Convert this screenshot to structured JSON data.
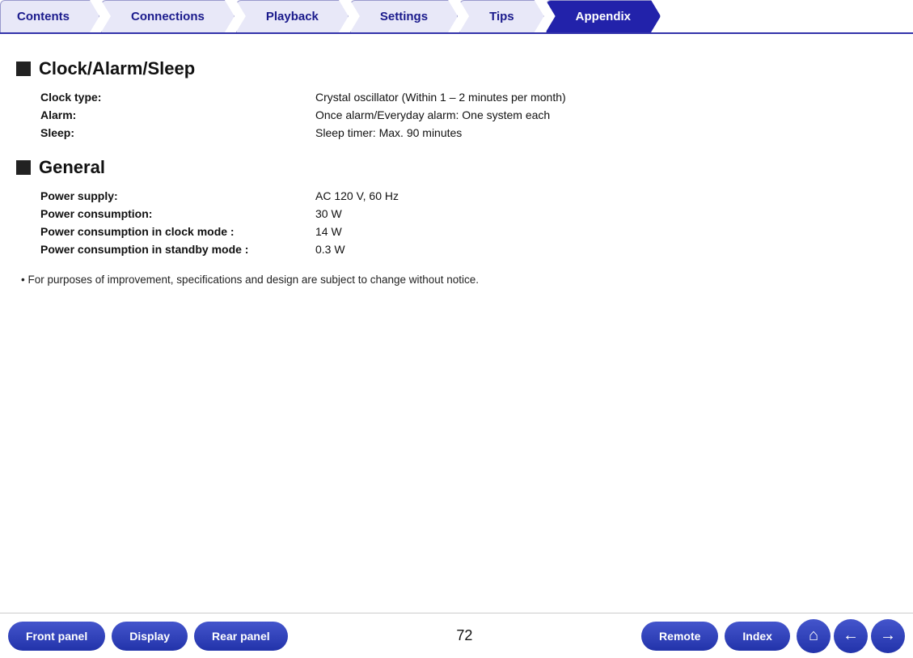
{
  "tabs": [
    {
      "label": "Contents",
      "active": false
    },
    {
      "label": "Connections",
      "active": false
    },
    {
      "label": "Playback",
      "active": false
    },
    {
      "label": "Settings",
      "active": false
    },
    {
      "label": "Tips",
      "active": false
    },
    {
      "label": "Appendix",
      "active": true
    }
  ],
  "sections": [
    {
      "id": "clock",
      "title": "Clock/Alarm/Sleep",
      "specs": [
        {
          "label": "Clock type:",
          "value": "Crystal oscillator (Within 1 – 2 minutes per month)"
        },
        {
          "label": "Alarm:",
          "value": "Once alarm/Everyday alarm: One system each"
        },
        {
          "label": "Sleep:",
          "value": "Sleep timer: Max. 90 minutes"
        }
      ]
    },
    {
      "id": "general",
      "title": "General",
      "specs": [
        {
          "label": "Power supply:",
          "value": "AC 120 V, 60 Hz"
        },
        {
          "label": "Power consumption:",
          "value": "30 W"
        },
        {
          "label": "Power consumption in clock mode :",
          "value": "14 W"
        },
        {
          "label": "Power consumption in standby mode :",
          "value": "0.3 W"
        }
      ]
    }
  ],
  "note": "For purposes of improvement, specifications and design are subject to change without notice.",
  "bottom": {
    "page_number": "72",
    "buttons": [
      {
        "label": "Front panel",
        "name": "front-panel-button"
      },
      {
        "label": "Display",
        "name": "display-button"
      },
      {
        "label": "Rear panel",
        "name": "rear-panel-button"
      },
      {
        "label": "Remote",
        "name": "remote-button"
      },
      {
        "label": "Index",
        "name": "index-button"
      }
    ],
    "icons": [
      {
        "name": "home-icon",
        "symbol": "⌂"
      },
      {
        "name": "back-icon",
        "symbol": "←"
      },
      {
        "name": "forward-icon",
        "symbol": "→"
      }
    ]
  }
}
